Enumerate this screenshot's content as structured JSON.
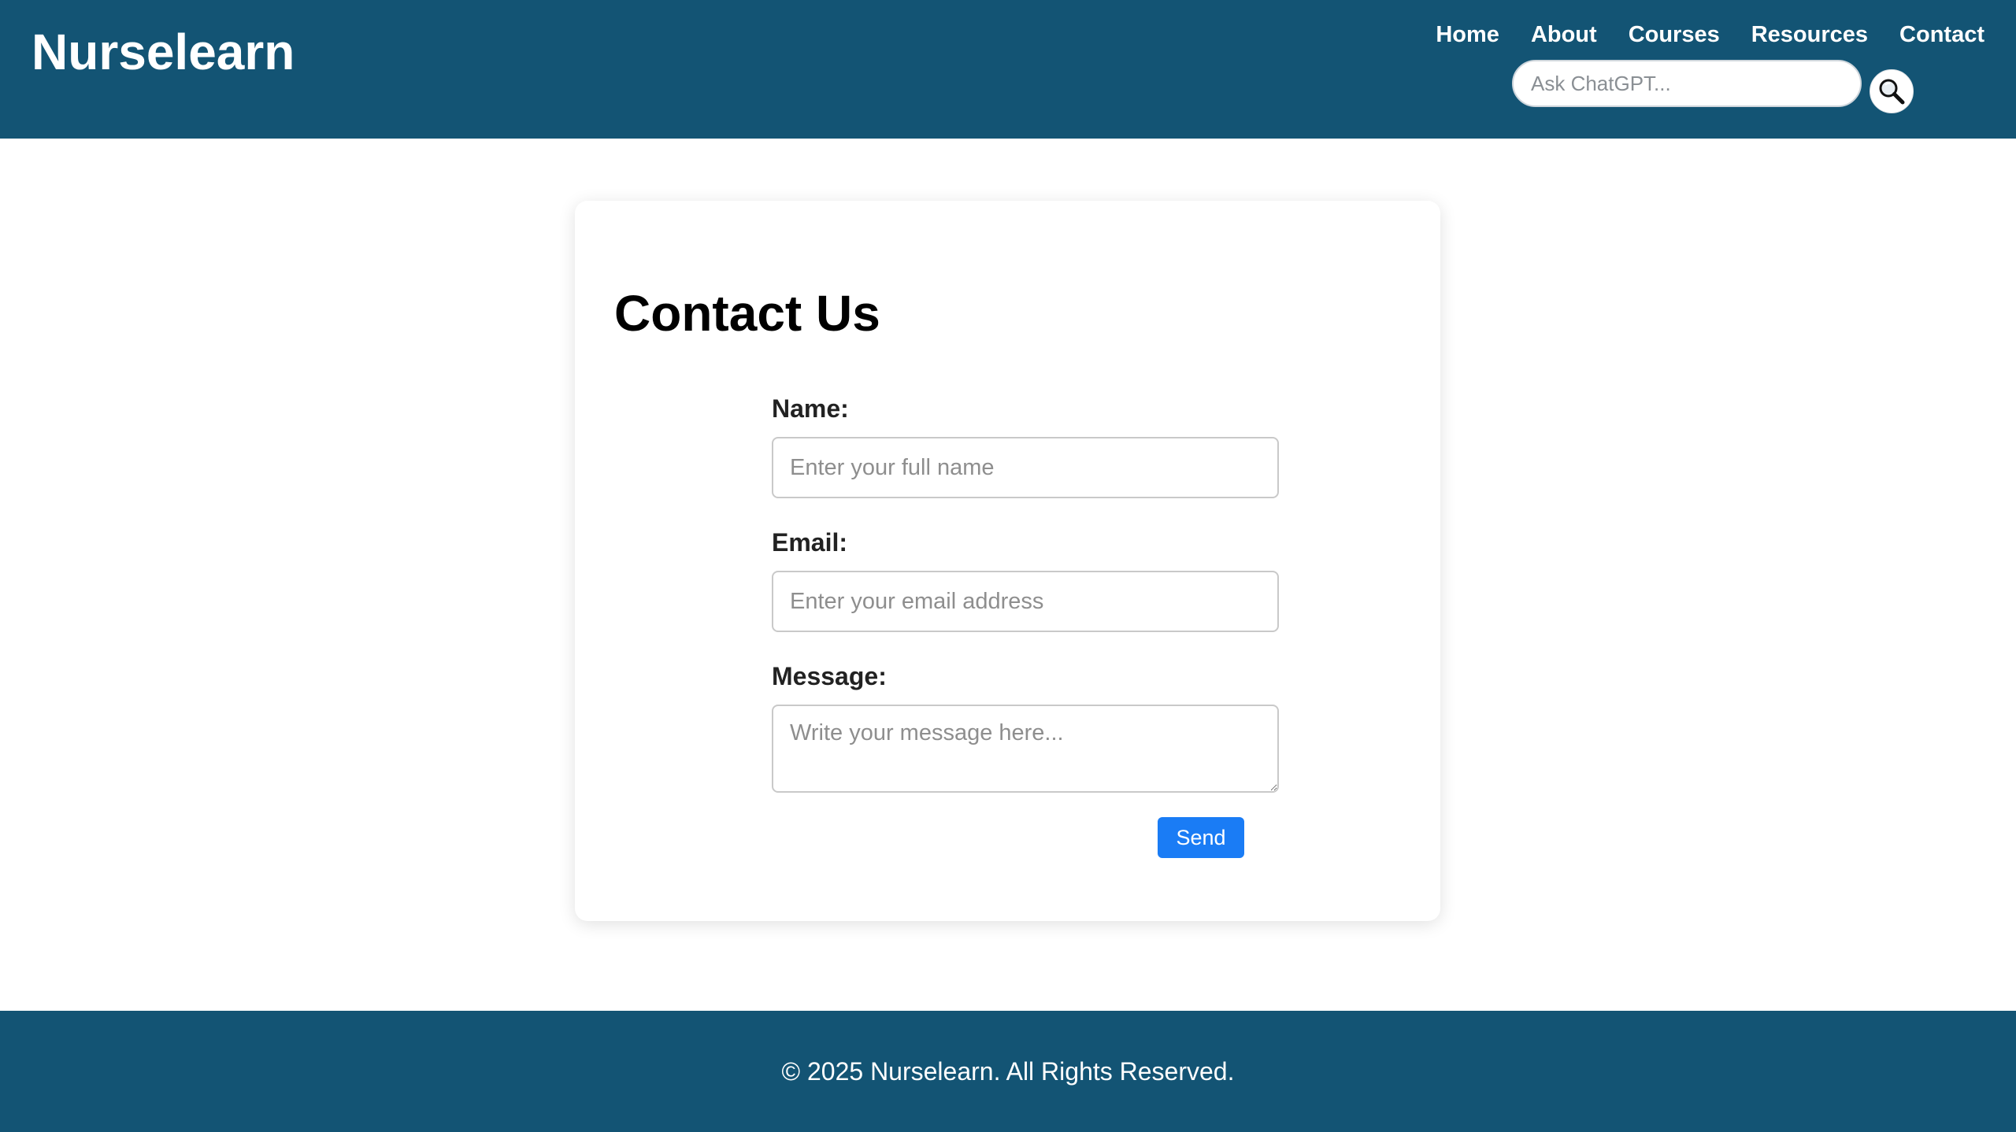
{
  "brand": {
    "name": "Nurselearn"
  },
  "nav": {
    "items": [
      {
        "label": "Home"
      },
      {
        "label": "About"
      },
      {
        "label": "Courses"
      },
      {
        "label": "Resources"
      },
      {
        "label": "Contact"
      }
    ]
  },
  "search": {
    "placeholder": "Ask ChatGPT...",
    "value": "",
    "button_icon": "search-icon"
  },
  "contact": {
    "title": "Contact Us",
    "name_label": "Name:",
    "name_placeholder": "Enter your full name",
    "email_label": "Email:",
    "email_placeholder": "Enter your email address",
    "message_label": "Message:",
    "message_placeholder": "Write your message here...",
    "send_label": "Send"
  },
  "footer": {
    "text": "© 2025 Nurselearn. All Rights Reserved."
  },
  "colors": {
    "header_bg": "#135474",
    "footer_bg": "#135474",
    "primary_button": "#1a7cf5"
  }
}
